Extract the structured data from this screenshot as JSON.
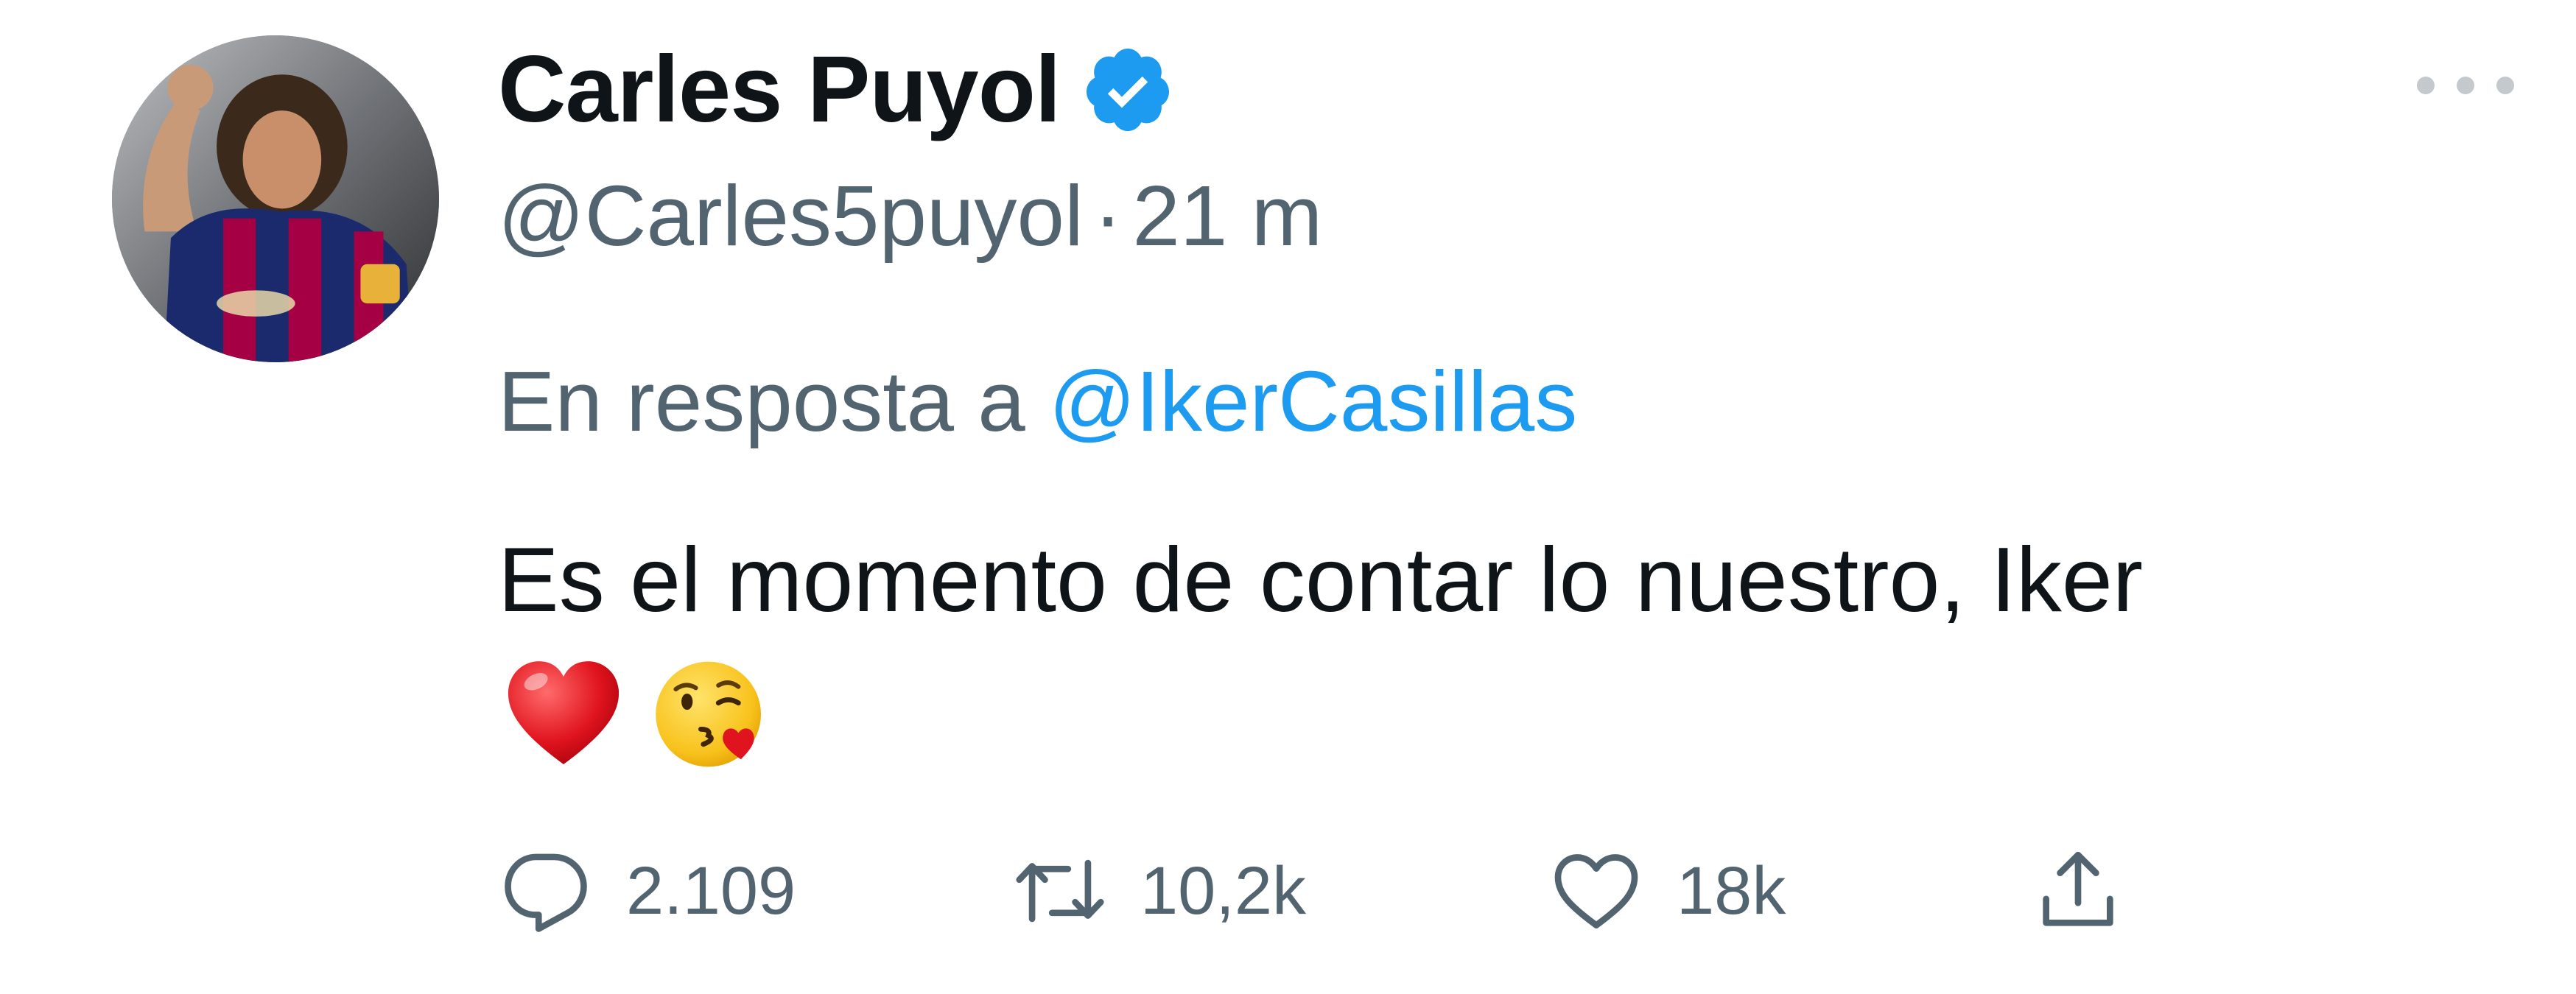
{
  "tweet": {
    "author": {
      "display_name": "Carles Puyol",
      "handle": "@Carles5puyol",
      "verified": true,
      "verified_icon": "verified-badge-icon"
    },
    "separator": "·",
    "time_ago": "21 m",
    "reply_prefix": "En resposta a",
    "reply_to": "@IkerCasillas",
    "text": "Es el momento de contar lo nuestro, Iker",
    "emojis": [
      "red-heart-emoji",
      "face-blowing-kiss-emoji"
    ],
    "actions": {
      "reply": {
        "icon": "reply-icon",
        "count": "2.109"
      },
      "retweet": {
        "icon": "retweet-icon",
        "count": "10,2k"
      },
      "like": {
        "icon": "heart-icon",
        "count": "18k"
      },
      "share": {
        "icon": "share-icon"
      }
    },
    "menu_icon": "more-options-icon"
  },
  "colors": {
    "text_primary": "#0f1419",
    "text_secondary": "#536471",
    "link": "#1d9bf0",
    "verified": "#1d9bf0",
    "background": "#ffffff"
  }
}
